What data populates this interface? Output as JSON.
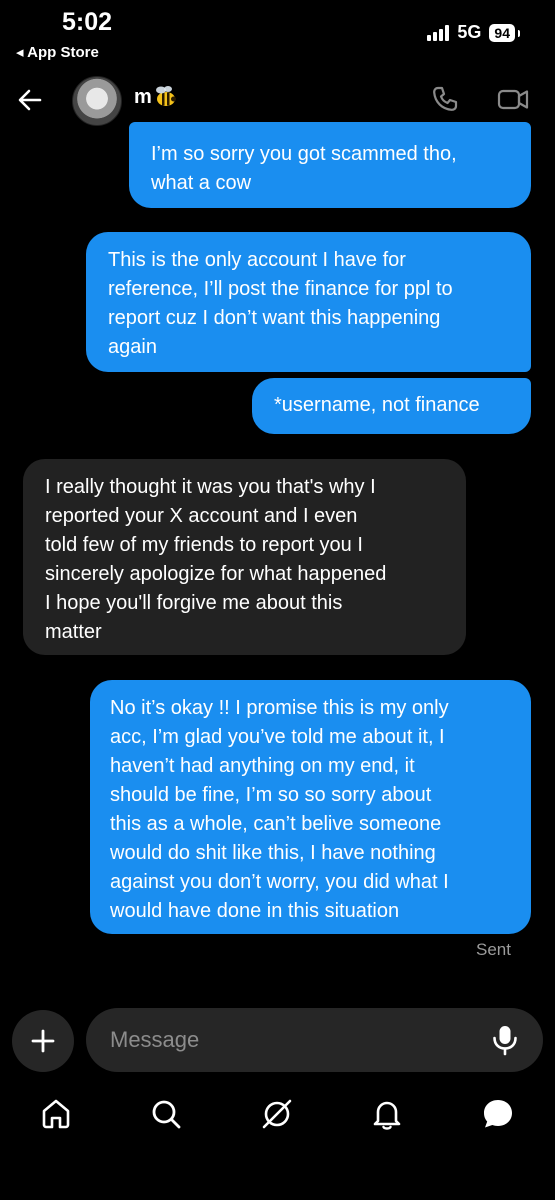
{
  "status_bar": {
    "time": "5:02",
    "back_app": "◂ App Store",
    "network": "5G",
    "battery": "94"
  },
  "header": {
    "contact_name": "m",
    "contact_emoji": "bee-icon"
  },
  "messages": [
    {
      "direction": "out",
      "lines": [
        "I’m so sorry you got scammed tho,",
        "what a cow"
      ]
    },
    {
      "direction": "out",
      "lines": [
        "This is the only account I have for",
        "reference, I’ll post the finance for ppl to",
        "report cuz I don’t want this happening",
        "again"
      ]
    },
    {
      "direction": "out",
      "lines": [
        "*username, not finance"
      ]
    },
    {
      "direction": "in",
      "lines": [
        "I really thought it was you that's why I",
        "reported your X account and I even",
        "told few of my friends to report you I",
        "sincerely apologize for what happened",
        "I hope you'll forgive me about this",
        "matter"
      ]
    },
    {
      "direction": "out",
      "lines": [
        "No it’s okay !! I promise this is my only",
        "acc, I’m glad you’ve told me about it, I",
        "haven’t had anything on my end, it",
        "should be fine, I’m so so sorry about",
        "this as a whole, can’t belive someone",
        "would do shit like this, I have nothing",
        "against you don’t worry, you did what I",
        "would have done in this situation"
      ]
    }
  ],
  "sent_label": "Sent",
  "composer": {
    "placeholder": "Message"
  },
  "colors": {
    "outgoing_bubble": "#1a8ef0",
    "incoming_bubble": "#222222",
    "background": "#000000"
  }
}
